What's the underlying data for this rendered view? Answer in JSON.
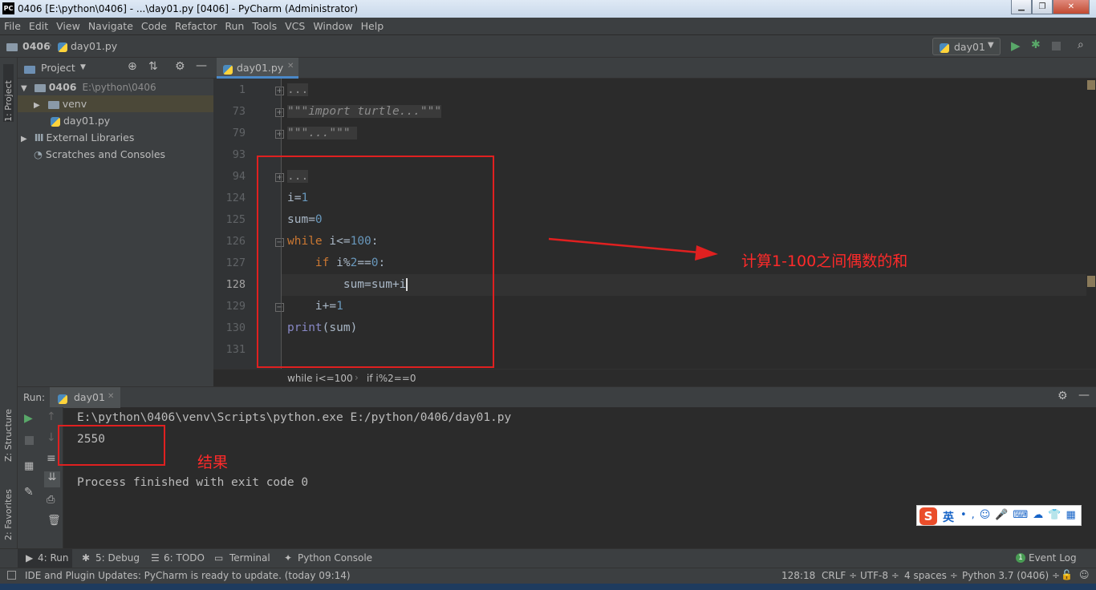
{
  "window": {
    "title": "0406 [E:\\python\\0406] - ...\\day01.py [0406] - PyCharm (Administrator)",
    "app_icon": "PC"
  },
  "menu": [
    "File",
    "Edit",
    "View",
    "Navigate",
    "Code",
    "Refactor",
    "Run",
    "Tools",
    "VCS",
    "Window",
    "Help"
  ],
  "nav": {
    "project": "0406",
    "file": "day01.py",
    "run_config": "day01"
  },
  "left_tabs": {
    "project": "1: Project",
    "structure": "Z: Structure",
    "favorites": "2: Favorites"
  },
  "project_panel": {
    "title": "Project",
    "tree": [
      {
        "label": "0406",
        "path": "E:\\python\\0406",
        "icon": "folder-icon"
      },
      {
        "label": "venv",
        "icon": "folder-icon"
      },
      {
        "label": "day01.py",
        "icon": "python-file-icon"
      },
      {
        "label": "External Libraries",
        "icon": "library-icon"
      },
      {
        "label": "Scratches and Consoles",
        "icon": "scratches-icon"
      }
    ]
  },
  "editor": {
    "tab": "day01.py",
    "line_numbers": [
      "1",
      "73",
      "79",
      "93",
      "94",
      "124",
      "125",
      "126",
      "127",
      "128",
      "129",
      "130",
      "131"
    ],
    "current_line": "128",
    "breadcrumb": [
      "while i<=100",
      "if i%2==0"
    ]
  },
  "annotations": {
    "code_note": "计算1-100之间偶数的和",
    "result_note": "结果"
  },
  "run": {
    "label": "Run:",
    "tab": "day01",
    "command": "E:\\python\\0406\\venv\\Scripts\\python.exe E:/python/0406/day01.py",
    "result": "2550",
    "finished": "Process finished with exit code 0"
  },
  "bottom_tabs": [
    "4: Run",
    "5: Debug",
    "6: TODO",
    "Terminal",
    "Python Console"
  ],
  "event_log": {
    "count": "1",
    "label": "Event Log"
  },
  "status": {
    "message": "IDE and Plugin Updates: PyCharm is ready to update. (today 09:14)",
    "position": "128:18",
    "line_sep": "CRLF ÷",
    "encoding": "UTF-8 ÷",
    "indent": "4 spaces ÷",
    "interpreter": "Python 3.7 (0406) ÷"
  },
  "ime": {
    "label": "英"
  }
}
